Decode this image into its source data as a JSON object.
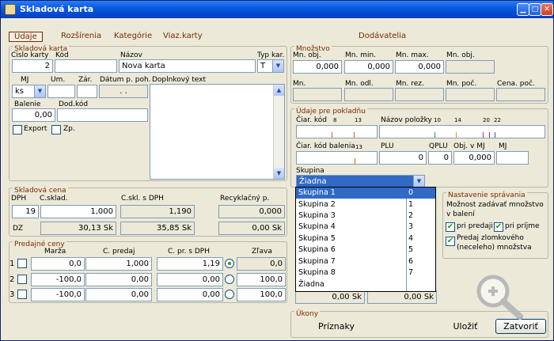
{
  "window": {
    "title": "Skladová karta"
  },
  "tabs": [
    "Údaje",
    "Rozšírenia",
    "Kategórie",
    "Viaz.karty",
    "Dodávatelia"
  ],
  "skladova_karta": {
    "title": "Skladová karta",
    "cislo_label": "Cislo karty",
    "cislo_value": "2",
    "kod_label": "Kód",
    "kod_value": "",
    "nazov_label": "Názov",
    "nazov_value": "Nova karta",
    "typ_label": "Typ kar.",
    "typ_value": "T",
    "mj_label": "MJ",
    "mj_value": "ks",
    "um_label": "Um.",
    "zar_label": "Zár.",
    "datum_label": "Dátum p. poh.",
    "datum_value": ". .",
    "doplnkovy_label": "Doplnkový text",
    "balenie_label": "Balenie",
    "balenie_value": "0,00",
    "dodkod_label": "Dod.kód",
    "export_label": "Export",
    "zp_label": "Zp."
  },
  "mnozstvo": {
    "title": "Množstvo",
    "row1_labels": [
      "Mn. obj.",
      "Mn. min.",
      "Mn. max.",
      "Mn. obj."
    ],
    "row1_values": [
      "0,000",
      "0,000",
      "0,000",
      ""
    ],
    "row2_labels": [
      "Mn.",
      "Mn. odl.",
      "Mn. rez.",
      "Mn. poč.",
      "Cena. poč."
    ],
    "row2_values": [
      "",
      "",
      "",
      "",
      ""
    ]
  },
  "pokladna": {
    "title": "Údaje pre pokladňu",
    "ciar_kod_label": "Čiar. kód",
    "nazov_polozky_label": "Názov položky",
    "ticks_a": [
      "8",
      "13"
    ],
    "ticks_b": [
      "10",
      "14",
      "20",
      "22"
    ],
    "ciar_kod_balenia_label": "Čiar. kód balenia",
    "ticks_c": [
      "13"
    ],
    "plu_label": "PLU",
    "plu_value": "0",
    "qplu_label": "QPLU",
    "qplu_value": "0",
    "objmj_label": "Obj. v MJ",
    "objmj_value": "0,000",
    "mj_label": "MJ",
    "mj_value": ""
  },
  "skupina": {
    "label": "Skupina",
    "value": "Žiadna",
    "options": [
      {
        "name": "Skupina 1",
        "code": "0"
      },
      {
        "name": "Skupina 2",
        "code": "1"
      },
      {
        "name": "Skupina 3",
        "code": "2"
      },
      {
        "name": "Skupina 4",
        "code": "3"
      },
      {
        "name": "Skupina 5",
        "code": "4"
      },
      {
        "name": "Skupina 6",
        "code": "5"
      },
      {
        "name": "Skupina 7",
        "code": "6"
      },
      {
        "name": "Skupina 8",
        "code": "7"
      },
      {
        "name": "Žiadna",
        "code": ""
      }
    ]
  },
  "hidden_values": [
    "0,00 Sk",
    "0,00 Sk"
  ],
  "skladova_cena": {
    "title": "Skladová cena",
    "dph_label": "DPH",
    "csklad_label": "C.sklad.",
    "cskl_dph_label": "C.skl. s DPH",
    "recykl_label": "Recyklačný p.",
    "dph_value": "19",
    "csklad_value": "1,000",
    "cskl_dph_value": "1,190",
    "recykl_value": "0,000",
    "dz_label": "DZ",
    "dz_value1": "30,13 Sk",
    "dz_value2": "35,85 Sk",
    "dz_value3": "0,00 Sk"
  },
  "predajne_ceny": {
    "title": "Predajné ceny",
    "headers": [
      "Marža",
      "C. predaj",
      "C. pr. s DPH",
      "Zľava"
    ],
    "rows": [
      {
        "idx": "1",
        "marza": "0,0",
        "cpredaj": "1,000",
        "cprdph": "1,19",
        "zlava": "0,0"
      },
      {
        "idx": "2",
        "marza": "-100,0",
        "cpredaj": "0,00",
        "cprdph": "0,00",
        "zlava": "100,0"
      },
      {
        "idx": "3",
        "marza": "-100,0",
        "cpredaj": "0,00",
        "cprdph": "0,00",
        "zlava": "100,0"
      }
    ]
  },
  "nastavenie": {
    "title": "Nastavenie správania",
    "text1": "Možnost zadávať množstvo",
    "text2": "v balení",
    "pri_predaji": "pri predaji",
    "pri_prijme": "pri príjme",
    "zlomkove1": "Predaj zlomkového",
    "zlomkove2": "(neceleho) množstva"
  },
  "ukony": {
    "title": "Úkony",
    "priznaky": "Príznaky",
    "ulozit": "Uložiť",
    "zatvorit": "Zatvoriť"
  },
  "colors": {
    "title_bar": "#0a5be0",
    "label_accent": "#7a2a00",
    "selection": "#316ac5",
    "check": "#21a121"
  }
}
